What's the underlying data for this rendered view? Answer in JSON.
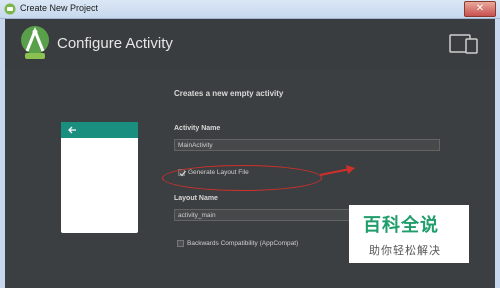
{
  "window": {
    "title": "Create New Project",
    "close_label": "✕"
  },
  "header": {
    "title": "Configure Activity"
  },
  "form": {
    "subtitle": "Creates a new empty activity",
    "activity_name_label": "Activity Name",
    "activity_name_value": "MainActivity",
    "generate_layout_label": "Generate Layout File",
    "generate_layout_checked": true,
    "layout_name_label": "Layout Name",
    "layout_name_value": "activity_main",
    "backwards_compat_label": "Backwards Compatibility (AppCompat)",
    "backwards_compat_checked": false
  },
  "preview": {
    "bar_color": "#1a8f7f"
  },
  "overlay": {
    "title": "百科全说",
    "subtitle": "助你轻松解决",
    "color": "#1f9d6b"
  },
  "icons": [
    "android-icon",
    "android-studio-logo-icon",
    "device-icon",
    "back-arrow-icon",
    "check-icon",
    "red-arrow-icon"
  ]
}
